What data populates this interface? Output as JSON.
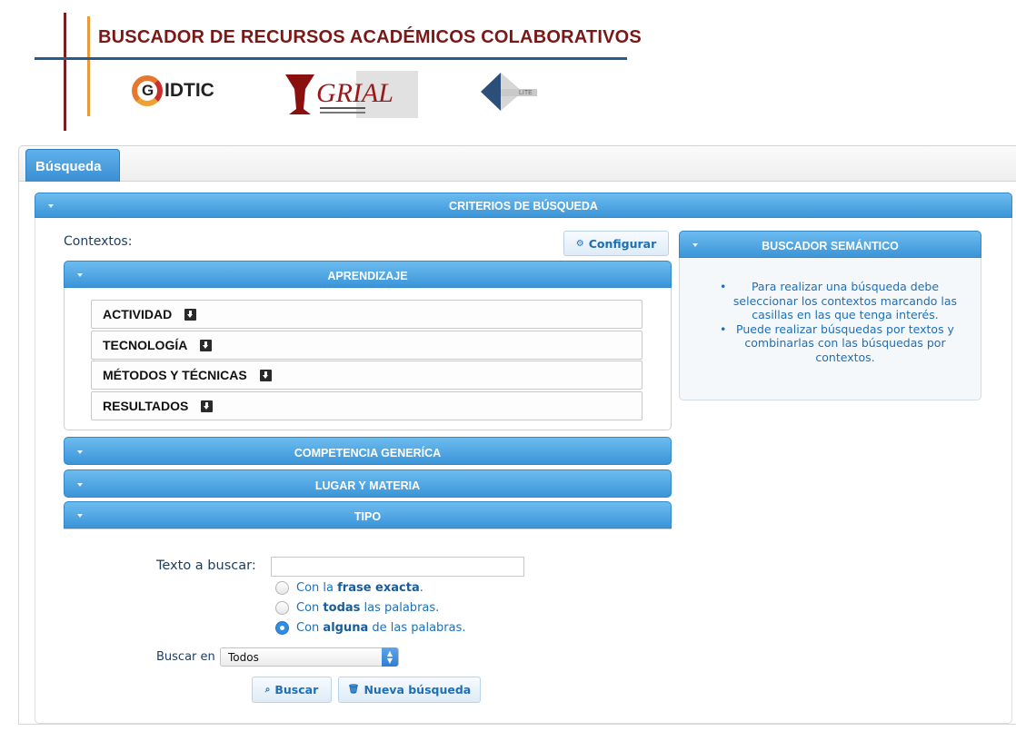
{
  "header": {
    "title": "BUSCADOR DE RECURSOS ACADÉMICOS COLABORATIVOS",
    "logos": [
      {
        "name": "GIDTIC",
        "text": "G",
        "rest": "IDTIC"
      },
      {
        "name": "GRIAL",
        "text": "GRIAL"
      },
      {
        "name": "LITE",
        "text": "LITE"
      }
    ]
  },
  "tabs": [
    {
      "label": "Búsqueda",
      "active": true
    }
  ],
  "criterios": {
    "title": "CRITERIOS DE BÚSQUEDA",
    "contextos_label": "Contextos:",
    "configurar_label": "Configurar",
    "sections": {
      "aprendizaje": {
        "title": "APRENDIZAJE",
        "items": [
          "ACTIVIDAD",
          "TECNOLOGÍA",
          "MÉTODOS Y TÉCNICAS",
          "RESULTADOS"
        ]
      },
      "competencia": {
        "title": "COMPETENCIA GENERÍCA"
      },
      "lugar": {
        "title": "LUGAR Y MATERIA"
      },
      "tipo": {
        "title": "TIPO"
      }
    }
  },
  "semantico": {
    "title": "BUSCADOR SEMÁNTICO",
    "tips": [
      "Para realizar una búsqueda debe seleccionar los contextos marcando las casillas en las que tenga interés.",
      "Puede realizar búsquedas por textos y combinarlas con las búsquedas por contextos."
    ]
  },
  "search": {
    "texto_label": "Texto a buscar:",
    "texto_value": "",
    "options": [
      {
        "pre": "Con la ",
        "bold": "frase exacta",
        "post": ".",
        "selected": false
      },
      {
        "pre": "Con ",
        "bold": "todas",
        "post": " las palabras.",
        "selected": false
      },
      {
        "pre": "Con ",
        "bold": "alguna",
        "post": " de las palabras.",
        "selected": true
      }
    ],
    "buscar_en_label": "Buscar en",
    "buscar_en_value": "Todos",
    "buscar_button": "Buscar",
    "nueva_button": "Nueva búsqueda"
  },
  "colors": {
    "accent_blue": "#3b95d8",
    "title_red": "#7a1818",
    "text_blue": "#1e6fb8"
  }
}
